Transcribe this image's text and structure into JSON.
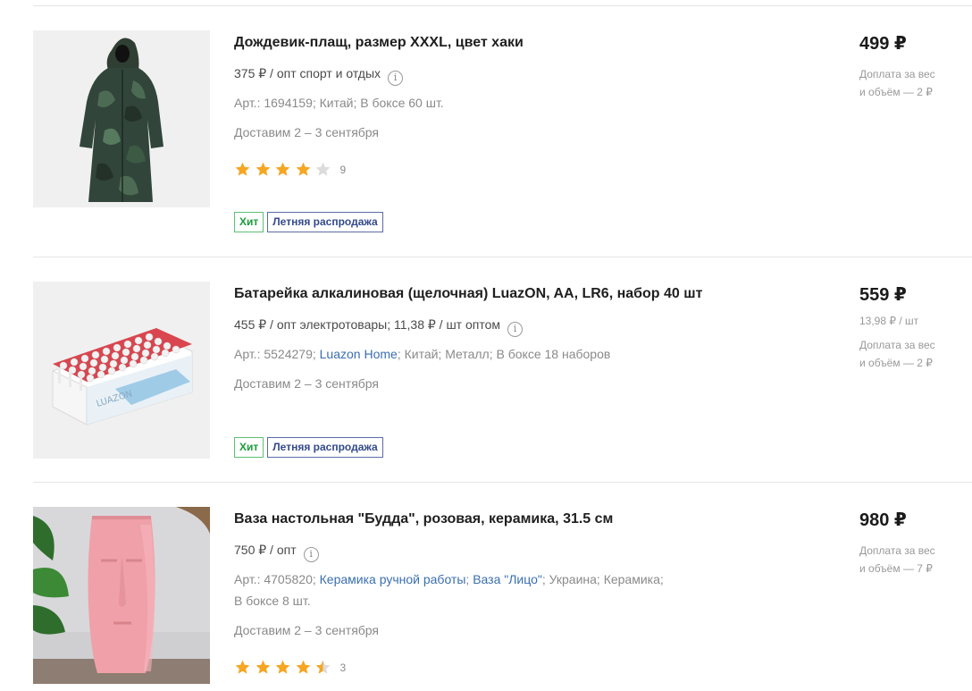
{
  "products": [
    {
      "title": "Дождевик-плащ, размер XXXL, цвет хаки",
      "opt": "375 ₽ / опт спорт и отдых",
      "meta": {
        "art": "Арт.: 1694159;",
        "country": "Китай;",
        "box": "В боксе 60 шт."
      },
      "delivery": "Доставим 2 – 3 сентября",
      "rating": 4,
      "rating_count": "9",
      "badges": [
        "Хит",
        "Летняя распродажа"
      ],
      "price": "499 ₽",
      "surcharge_line1": "Доплата за вес",
      "surcharge_line2": "и объём — 2 ₽"
    },
    {
      "title": "Батарейка алкалиновая (щелочная) LuazON, AA, LR6, набор 40 шт",
      "opt": "455 ₽ / опт электротовары; 11,38 ₽ / шт оптом",
      "meta": {
        "art": "Арт.: 5524279;",
        "brand": "Luazon Home",
        "rest": "; Китай; Металл; В боксе 18 наборов"
      },
      "delivery": "Доставим 2 – 3 сентября",
      "badges": [
        "Хит",
        "Летняя распродажа"
      ],
      "price": "559 ₽",
      "unit_price": "13,98 ₽ / шт",
      "surcharge_line1": "Доплата за вес",
      "surcharge_line2": "и объём — 2 ₽"
    },
    {
      "title": "Ваза настольная \"Будда\", розовая, керамика, 31.5 см",
      "opt": "750 ₽ / опт",
      "meta": {
        "art": "Арт.: 4705820;",
        "link1": "Керамика ручной работы",
        "sep": ";",
        "link2": "Ваза \"Лицо\"",
        "rest": "; Украина; Керамика;",
        "box": "В боксе 8 шт."
      },
      "delivery": "Доставим 2 – 3 сентября",
      "rating": 4.5,
      "rating_count": "3",
      "price": "980 ₽",
      "surcharge_line1": "Доплата за вес",
      "surcharge_line2": "и объём — 7 ₽"
    }
  ],
  "colors": {
    "star_filled": "#f5a623",
    "star_empty": "#dcdcdc",
    "link": "#3a6fb0",
    "hit": "#1a9c3a",
    "sale": "#334a8c"
  }
}
